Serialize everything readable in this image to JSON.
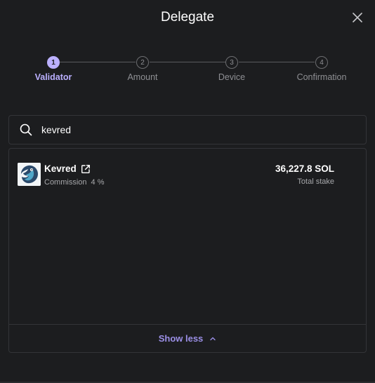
{
  "modal": {
    "title": "Delegate"
  },
  "stepper": {
    "steps": [
      {
        "number": "1",
        "label": "Validator",
        "active": true
      },
      {
        "number": "2",
        "label": "Amount",
        "active": false
      },
      {
        "number": "3",
        "label": "Device",
        "active": false
      },
      {
        "number": "4",
        "label": "Confirmation",
        "active": false
      }
    ]
  },
  "search": {
    "value": "kevred",
    "icon": "search-icon"
  },
  "validators": [
    {
      "name": "Kevred",
      "commission_label": "Commission",
      "commission_value": "4 %",
      "stake": "36,227.8 SOL",
      "stake_label": "Total stake"
    }
  ],
  "list_footer": {
    "toggle_label": "Show less"
  },
  "colors": {
    "accent": "#bbb0ff",
    "background": "#1c1d1f",
    "border": "#333438"
  }
}
